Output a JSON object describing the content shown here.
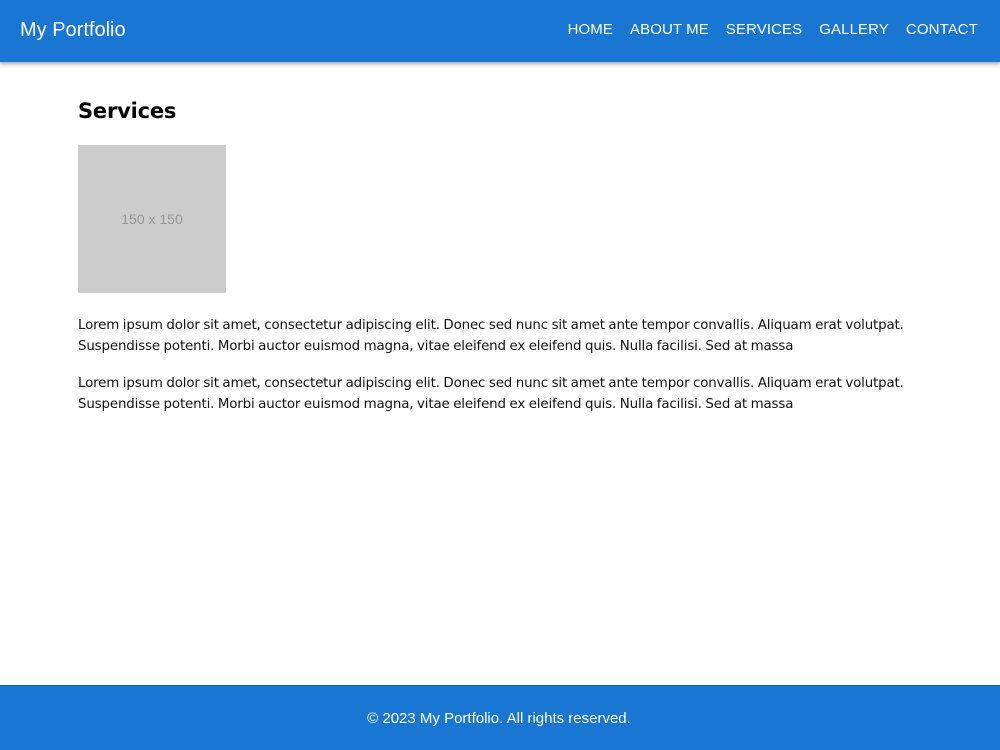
{
  "header": {
    "brand": "My Portfolio",
    "nav": [
      {
        "label": "HOME"
      },
      {
        "label": "ABOUT ME"
      },
      {
        "label": "SERVICES"
      },
      {
        "label": "GALLERY"
      },
      {
        "label": "CONTACT"
      }
    ],
    "color": "#1976d2"
  },
  "main": {
    "title": "Services",
    "image_placeholder": "150 x 150",
    "paragraphs": [
      "Lorem ipsum dolor sit amet, consectetur adipiscing elit. Donec sed nunc sit amet ante tempor convallis. Aliquam erat volutpat. Suspendisse potenti. Morbi auctor euismod magna, vitae eleifend ex eleifend quis. Nulla facilisi. Sed at massa",
      "Lorem ipsum dolor sit amet, consectetur adipiscing elit. Donec sed nunc sit amet ante tempor convallis. Aliquam erat volutpat. Suspendisse potenti. Morbi auctor euismod magna, vitae eleifend ex eleifend quis. Nulla facilisi. Sed at massa"
    ]
  },
  "footer": {
    "text": "© 2023 My Portfolio. All rights reserved."
  }
}
